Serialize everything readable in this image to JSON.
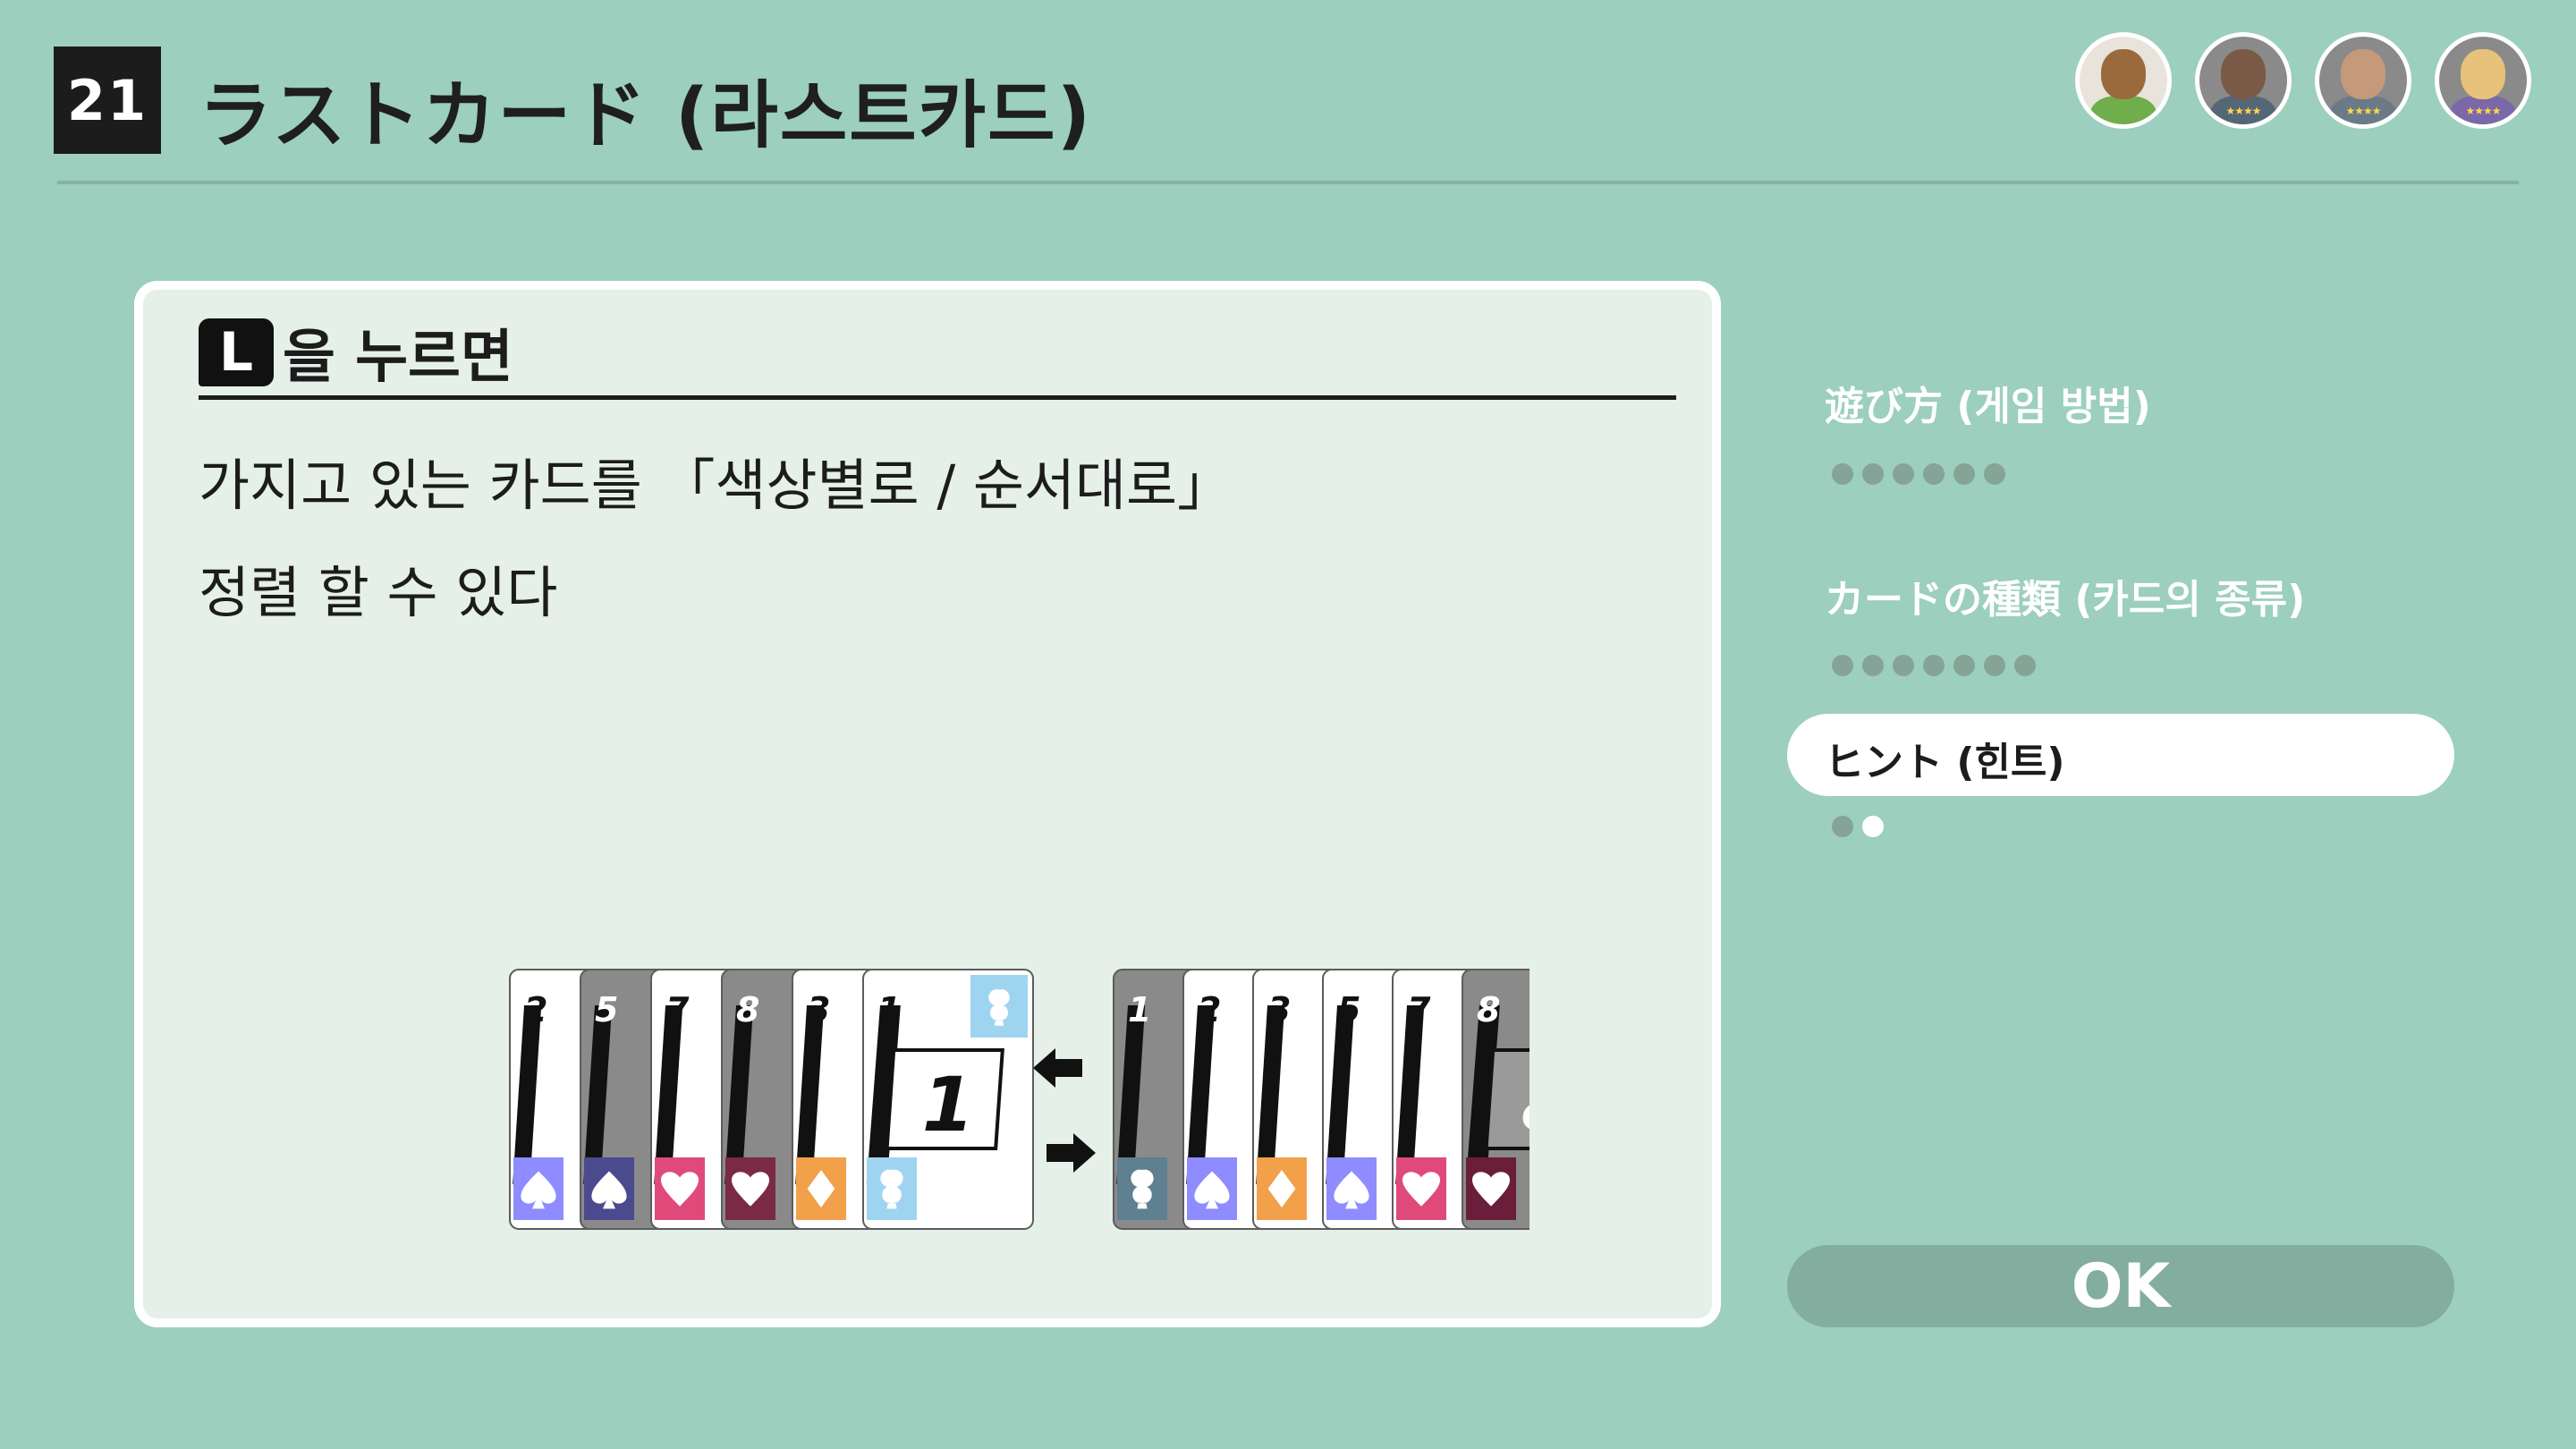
{
  "header": {
    "game_number": "21",
    "title": "ラストカード (라스트카드)"
  },
  "players": [
    {
      "name": "tanuki-avatar",
      "colors": {
        "head": "#9a6a3c",
        "body": "#6fae4a"
      }
    },
    {
      "name": "player-avatar-2",
      "colors": {
        "head": "#7a5a46",
        "body": "#556677"
      },
      "stars": "★★★★"
    },
    {
      "name": "player-avatar-3",
      "colors": {
        "head": "#c49a7a",
        "body": "#6a7a86"
      },
      "stars": "★★★★"
    },
    {
      "name": "player-avatar-4",
      "colors": {
        "head": "#e8c27a",
        "body": "#7a68a8"
      },
      "stars": "★★★★"
    }
  ],
  "panel": {
    "button_glyph": "L",
    "heading": "을 누르면",
    "description_line1": "가지고 있는 카드를 「색상별로 / 순서대로」",
    "description_line2": "정렬 할 수 있다"
  },
  "illustration": {
    "left_hand": [
      {
        "rank": "2",
        "suit": "spade",
        "color": "#8e8cff",
        "dim": false
      },
      {
        "rank": "5",
        "suit": "spade",
        "color": "#4b4a8e",
        "dim": true
      },
      {
        "rank": "7",
        "suit": "heart",
        "color": "#e04a7a",
        "dim": false
      },
      {
        "rank": "8",
        "suit": "heart",
        "color": "#7a2a44",
        "dim": true
      },
      {
        "rank": "3",
        "suit": "diamond",
        "color": "#f2a04a",
        "dim": false
      },
      {
        "rank": "1",
        "suit": "club",
        "color": "#9fd4f0",
        "dim": false,
        "front": true
      }
    ],
    "right_hand": [
      {
        "rank": "1",
        "suit": "club",
        "color": "#5e8090",
        "dim": true
      },
      {
        "rank": "2",
        "suit": "spade",
        "color": "#8e8cff",
        "dim": false
      },
      {
        "rank": "3",
        "suit": "diamond",
        "color": "#f2a04a",
        "dim": false
      },
      {
        "rank": "5",
        "suit": "spade",
        "color": "#8e8cff",
        "dim": false
      },
      {
        "rank": "7",
        "suit": "heart",
        "color": "#e04a7a",
        "dim": false
      },
      {
        "rank": "8",
        "suit": "heart",
        "color": "#6a1e3a",
        "dim": true,
        "front": true
      }
    ]
  },
  "menu": {
    "items": [
      {
        "label": "遊び方 (게임 방법)",
        "dots_total": 6,
        "dots_active": 0,
        "selected": false
      },
      {
        "label": "カードの種類 (카드의 종류)",
        "dots_total": 7,
        "dots_active": 0,
        "selected": false
      },
      {
        "label": "ヒント (힌트)",
        "dots_total": 2,
        "dots_active": 1,
        "selected": true
      }
    ]
  },
  "ok_button": {
    "label": "OK"
  },
  "colors": {
    "background": "#9ccfbd",
    "panel": "#e4f0e8",
    "accent_dark": "#1c1c1c"
  }
}
